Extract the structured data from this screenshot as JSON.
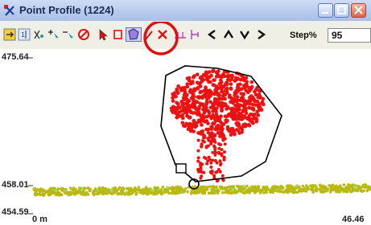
{
  "window": {
    "title": "Point Profile (1224)"
  },
  "toolbar": {
    "step_label": "Step%",
    "step_value": "95",
    "icons": [
      "profile-options-icon",
      "one-to-one-icon",
      "auto-classify-icon",
      "add-point-icon",
      "remove-point-icon",
      "cancel-icon",
      "select-arrow-icon",
      "select-rect-icon",
      "polygon-select-icon",
      "pencil-icon",
      "delete-icon",
      "level-line-icon",
      "vertical-line-icon",
      "step-left-icon",
      "step-up-icon",
      "step-down-icon",
      "step-right-icon"
    ]
  },
  "plot": {
    "y_top_label": "475.64",
    "y_mid_label": "458.01",
    "y_bottom_label": "454.59",
    "x_left_label": "0 m",
    "x_right_label": "46.46",
    "colors": {
      "high_points": "#ee1111",
      "ground": "#b9b912",
      "outline": "#000000",
      "highlight": "#dd1111"
    }
  }
}
